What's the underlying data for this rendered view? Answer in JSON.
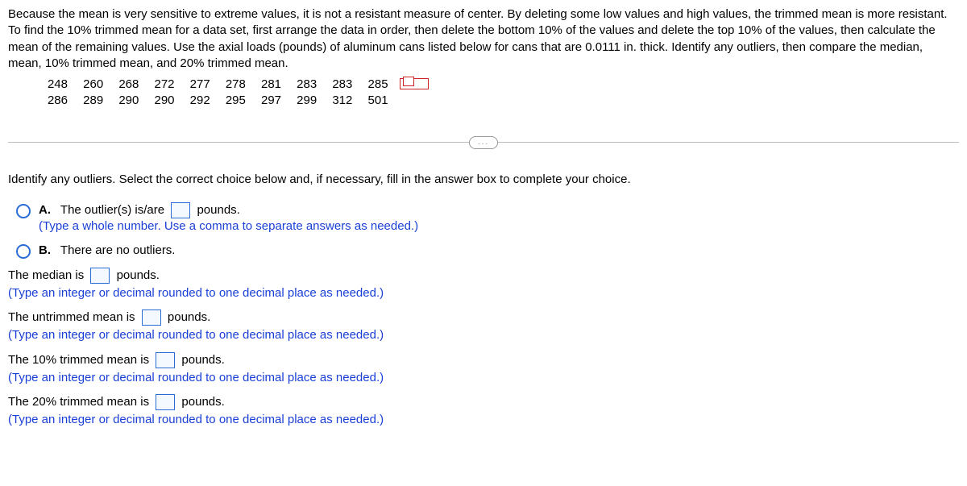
{
  "intro": "Because the mean is very sensitive to extreme values, it is not a resistant measure of center. By deleting some low values and high values, the trimmed mean is more resistant. To find the 10% trimmed mean for a data set, first arrange the data in order, then delete the bottom 10% of the values and delete the top 10% of the values, then calculate the mean of the remaining values. Use the axial loads (pounds) of aluminum cans listed below for cans that are 0.0111 in. thick. Identify any outliers, then compare the median, mean, 10% trimmed mean, and 20% trimmed mean.",
  "data": {
    "row1": [
      "248",
      "260",
      "268",
      "272",
      "277",
      "278",
      "281",
      "283",
      "283",
      "285"
    ],
    "row2": [
      "286",
      "289",
      "290",
      "290",
      "292",
      "295",
      "297",
      "299",
      "312",
      "501"
    ]
  },
  "pill": "...",
  "prompt": "Identify any outliers. Select the correct choice below and, if necessary, fill in the answer box to complete your choice.",
  "choices": {
    "A": {
      "label": "A.",
      "pre": "The outlier(s) is/are",
      "post": "pounds.",
      "hint": "(Type a whole number. Use a comma to separate answers as needed.)"
    },
    "B": {
      "label": "B.",
      "text": "There are no outliers."
    }
  },
  "q": {
    "median": {
      "pre": "The median is",
      "post": "pounds.",
      "hint": "(Type an integer or decimal rounded to one decimal place as needed.)"
    },
    "mean": {
      "pre": "The untrimmed mean is",
      "post": "pounds.",
      "hint": "(Type an integer or decimal rounded to one decimal place as needed.)"
    },
    "t10": {
      "pre": "The 10% trimmed mean is",
      "post": "pounds.",
      "hint": "(Type an integer or decimal rounded to one decimal place as needed.)"
    },
    "t20": {
      "pre": "The 20% trimmed mean is",
      "post": "pounds.",
      "hint": "(Type an integer or decimal rounded to one decimal place as needed.)"
    }
  }
}
